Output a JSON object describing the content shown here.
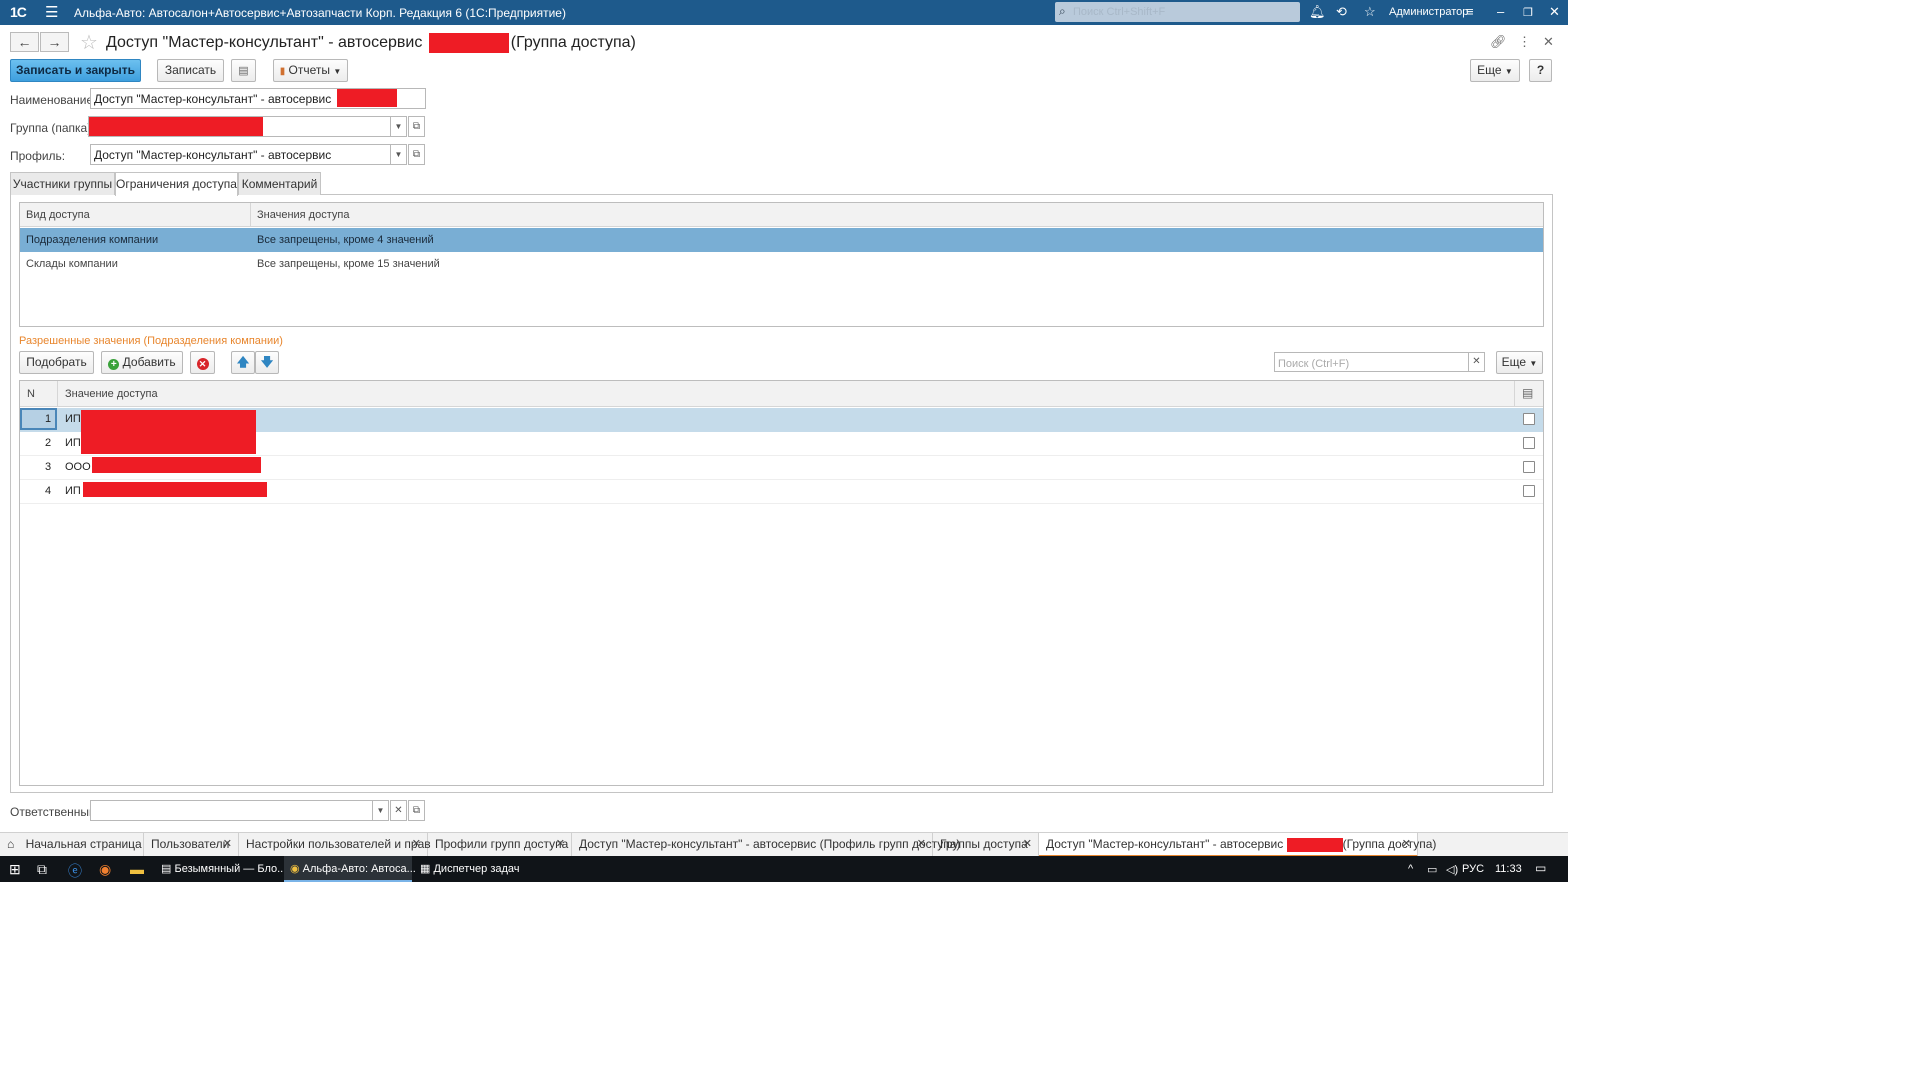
{
  "window": {
    "logo": "1С",
    "title": "Альфа-Авто: Автосалон+Автосервис+Автозапчасти Корп. Редакция 6  (1С:Предприятие)",
    "search_placeholder": "Поиск Ctrl+Shift+F",
    "user": "Администратор"
  },
  "form": {
    "title_prefix": "Доступ \"Мастер-консультант\" - автосервис",
    "title_suffix": "(Группа доступа)"
  },
  "toolbar": {
    "save_close": "Записать и закрыть",
    "save": "Записать",
    "reports": "Отчеты",
    "more": "Еще",
    "help": "?"
  },
  "fields": {
    "name_label": "Наименование:",
    "name_value": "Доступ \"Мастер-консультант\" - автосервис",
    "group_label": "Группа (папка):",
    "group_value": "",
    "profile_label": "Профиль:",
    "profile_value": "Доступ \"Мастер-консультант\" - автосервис",
    "responsible_label": "Ответственный:",
    "responsible_value": ""
  },
  "tabs": [
    {
      "label": "Участники группы",
      "active": false
    },
    {
      "label": "Ограничения доступа",
      "active": true
    },
    {
      "label": "Комментарий",
      "active": false
    }
  ],
  "access_table": {
    "columns": [
      "Вид доступа",
      "Значения доступа"
    ],
    "rows": [
      {
        "kind": "Подразделения компании",
        "values": "Все запрещены, кроме 4 значений",
        "selected": true
      },
      {
        "kind": "Склады компании",
        "values": "Все запрещены, кроме 15 значений",
        "selected": false
      }
    ]
  },
  "allowed": {
    "title": "Разрешенные значения (Подразделения компании)",
    "pick": "Подобрать",
    "add": "Добавить",
    "search_placeholder": "Поиск (Ctrl+F)",
    "more": "Еще",
    "columns": [
      "N",
      "Значение доступа"
    ],
    "rows": [
      {
        "n": "1",
        "value": "ИП"
      },
      {
        "n": "2",
        "value": "ИП"
      },
      {
        "n": "3",
        "value": "ООО"
      },
      {
        "n": "4",
        "value": "ИП"
      }
    ]
  },
  "open_tabs": [
    {
      "label": "Начальная страница",
      "closable": false
    },
    {
      "label": "Пользователи",
      "closable": true
    },
    {
      "label": "Настройки пользователей и прав",
      "closable": true
    },
    {
      "label": "Профили групп доступа",
      "closable": true
    },
    {
      "label": "Доступ \"Мастер-консультант\" - автосервис (Профиль групп доступа)",
      "closable": true
    },
    {
      "label": "Группы доступа",
      "closable": true
    },
    {
      "label_prefix": "Доступ \"Мастер-консультант\" - автосервис",
      "label_suffix": "(Группа доступа)",
      "closable": true,
      "active": true
    }
  ],
  "taskbar": {
    "apps": [
      "Безымянный — Бло...",
      "Альфа-Авто: Автоса...",
      "Диспетчер задач"
    ],
    "lang": "РУС",
    "time": "11:33"
  },
  "colors": {
    "titlebar": "#1e5a8c",
    "primary_button": "#3e9fde",
    "selected_row": "#79aed4",
    "accent_orange": "#e8862d",
    "redaction": "#ee1c25"
  }
}
